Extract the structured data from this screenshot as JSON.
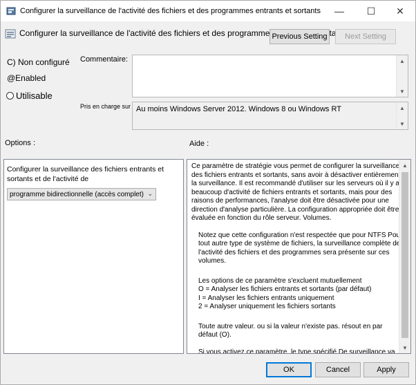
{
  "window": {
    "title": "Configurer la surveillance de l'activité des fichiers et des programmes entrants et sortants",
    "minimize_glyph": "—",
    "maximize_glyph": "☐",
    "close_glyph": "✕"
  },
  "header": {
    "title": "Configurer la surveillance de l'activité des fichiers et des programmes entrants et sortants",
    "previous_setting": "Previous Setting",
    "next_setting": "Next Setting"
  },
  "state": {
    "not_configured": "C) Non configuré",
    "enabled": "@Enabled",
    "usable": "Utilisable"
  },
  "comment": {
    "label": "Commentaire:"
  },
  "supported": {
    "label": "Pris en charge sur :",
    "value": "Au moins Windows Server 2012. Windows 8 ou Windows RT"
  },
  "options": {
    "label": "Options :",
    "description": "Configurer la surveillance des fichiers entrants et sortants et de l'activité de",
    "selected": "programme bidirectionnelle (accès complet)"
  },
  "help": {
    "label": "Aide :",
    "paragraphs": [
      "Ce paramètre de stratégie vous permet de configurer la surveillance des fichiers entrants et sortants, sans avoir à désactiver entièrement la surveillance. Il est recommandé d'utiliser sur les serveurs où il y a beaucoup d'activité de fichiers entrants et sortants, mais pour des raisons de performances, l'analyse doit être désactivée pour une direction d'analyse particulière. La configuration appropriée doit être évaluée en fonction du rôle serveur. Volumes.",
      "Notez que cette configuration n'est respectée que pour NTFS Pour tout autre type de système de fichiers, la surveillance complète de l'activité des fichiers et des programmes sera présente sur ces volumes.",
      "Les options de ce paramètre s'excluent mutuellement",
      "O = Analyser les fichiers entrants et sortants (par défaut)",
      "I = Analyser les fichiers entrants uniquement",
      "2 = Analyser uniquement les fichiers sortants",
      "Toute autre valeur. ou si la valeur n'existe pas. résout en par défaut (O).",
      "Si vous activez ce paramètre. le type spécifié De surveillance va"
    ]
  },
  "footer": {
    "ok": "OK",
    "cancel": "Cancel",
    "apply": "Apply"
  },
  "scroll_glyphs": {
    "up": "▲",
    "down": "▼"
  },
  "select_glyph": "⌄"
}
